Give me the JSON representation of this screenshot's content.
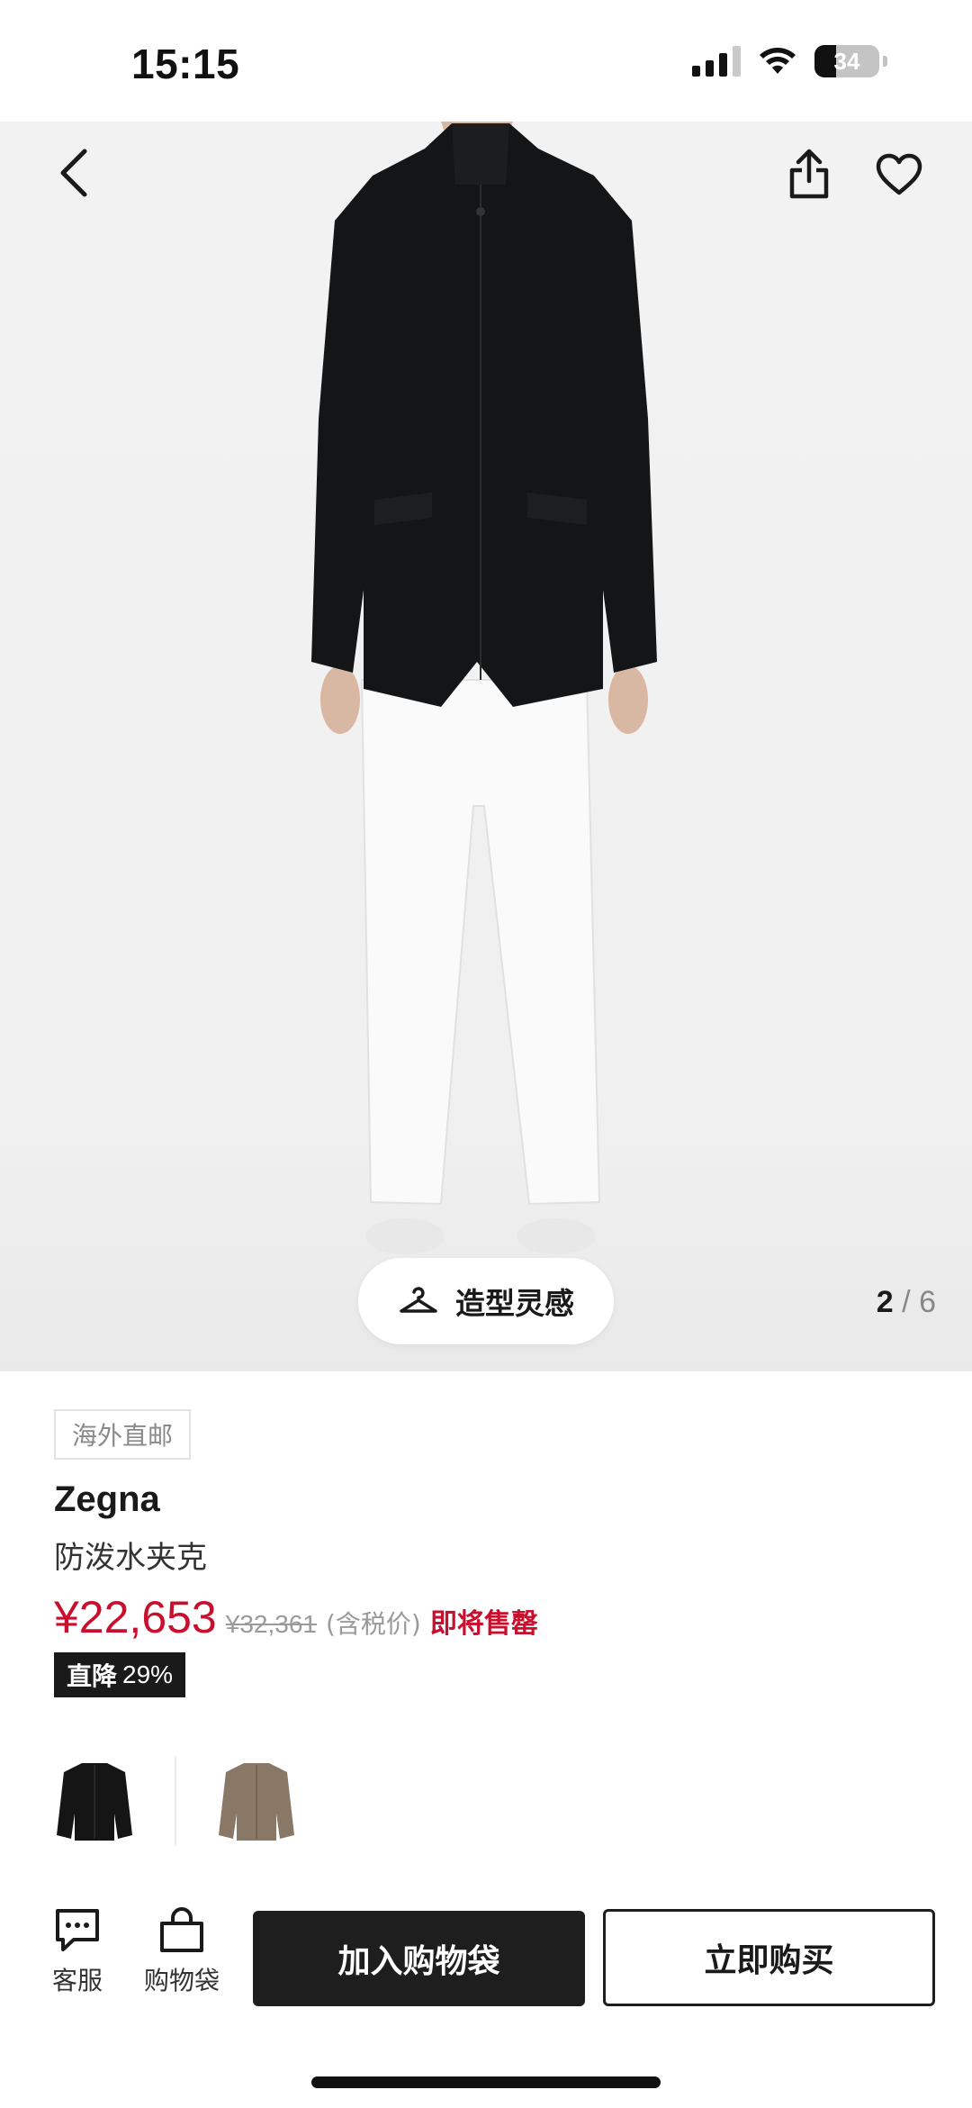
{
  "status_bar": {
    "time": "15:15",
    "battery": "34",
    "battery_level": 0.34,
    "signal_bars": 3
  },
  "hero": {
    "back_icon": "chevron-left-icon",
    "share_icon": "share-icon",
    "favorite_icon": "heart-icon",
    "styling_label": "造型灵感",
    "styling_icon": "hanger-icon",
    "page_current": "2",
    "page_separator": "/",
    "page_total": "6"
  },
  "product": {
    "tag": "海外直邮",
    "brand": "Zegna",
    "name": "防泼水夹克",
    "price": "¥22,653",
    "original_price": "¥32,361",
    "tax_note": "(含税价)",
    "stock_note": "即将售罄",
    "discount_label": "直降",
    "discount_value": "29%",
    "variants": [
      {
        "color": "#151515",
        "name": "black-variant"
      },
      {
        "color": "#8a7866",
        "name": "taupe-variant"
      }
    ]
  },
  "bottom_bar": {
    "customer_service": "客服",
    "bag": "购物袋",
    "add_to_bag": "加入购物袋",
    "buy_now": "立即购买"
  },
  "colors": {
    "price_red": "#c8102e",
    "dark": "#1e1e1e"
  }
}
